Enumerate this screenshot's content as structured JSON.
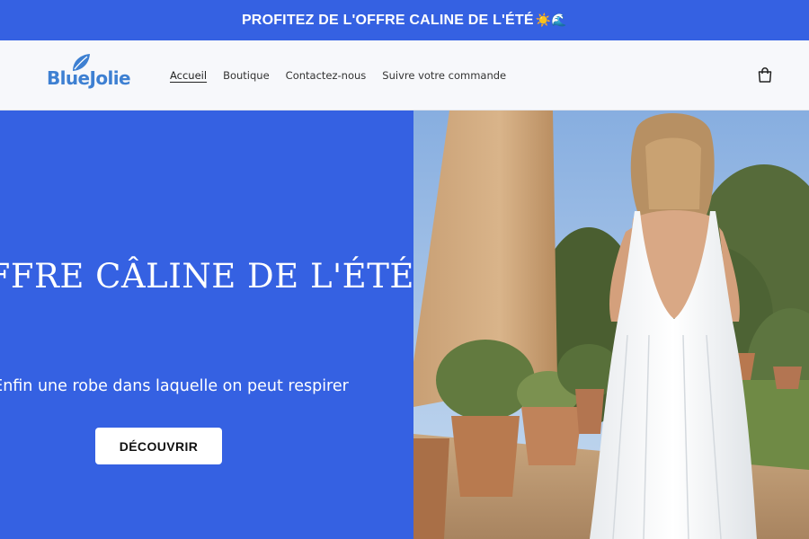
{
  "announcement": {
    "text": "PROFITEZ DE L'OFFRE CALINE DE L'ÉTÉ",
    "emoji": "☀️🌊"
  },
  "header": {
    "logo_text": "BlueJolie",
    "nav": [
      {
        "label": "Accueil",
        "active": true
      },
      {
        "label": "Boutique",
        "active": false
      },
      {
        "label": "Contactez-nous",
        "active": false
      },
      {
        "label": "Suivre votre commande",
        "active": false
      }
    ],
    "cart_icon": "shopping-bag-icon"
  },
  "hero": {
    "title": "L'OFFRE CÂLINE DE L'ÉTÉ",
    "subtitle": "Enfin une robe dans laquelle on peut respirer",
    "cta_label": "DÉCOUVRIR",
    "image": "woman-in-white-backless-dress-garden-photo"
  },
  "colors": {
    "brand_blue": "#3561e2",
    "logo_blue": "#3e80d2",
    "header_bg": "#f7f8fb"
  }
}
